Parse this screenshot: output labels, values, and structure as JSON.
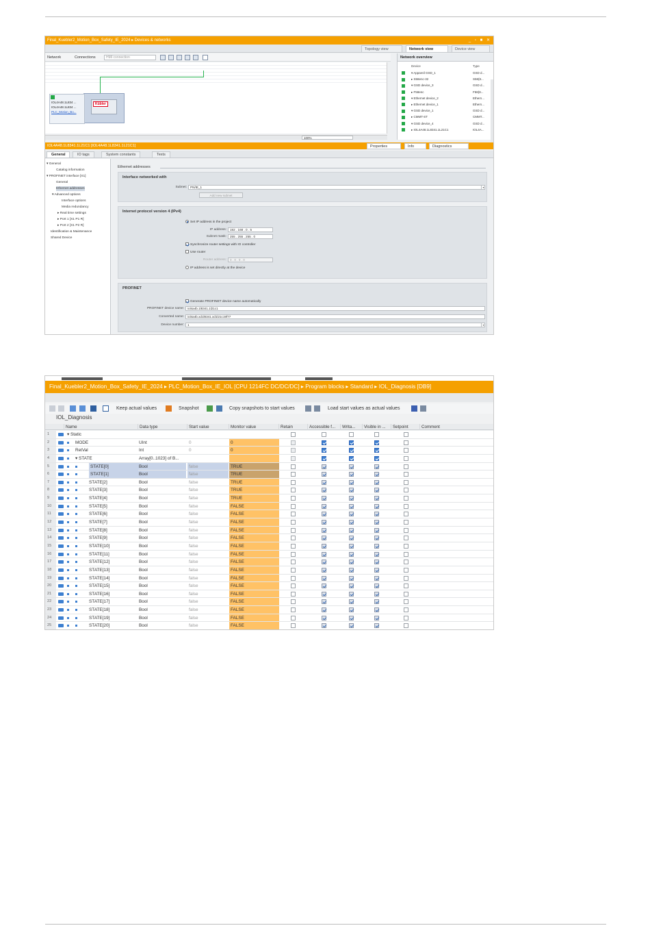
{
  "screenshot1": {
    "title": "Final_Kuebler2_Motion_Box_Safety_IE_2024 ▸ Devices & networks",
    "window_buttons": "_ ▫ ■ ✕",
    "view_tabs": [
      "Topology view",
      "Network view",
      "Device view"
    ],
    "toolbar": {
      "network": "Network",
      "connections": "Connections",
      "connection_type": "HMI connection"
    },
    "device_box": {
      "line1": "IOL4A48.1L834 ...",
      "line2": "IOL4A48.1L834 ...",
      "link": "PLC_Motion_Bo..."
    },
    "device_logo": "Kübler",
    "zoom": "100%",
    "overview": {
      "title": "Network overview",
      "col_device": "Device",
      "col_type": "Type",
      "rows": [
        {
          "name": "▾ Appareil GSD_1",
          "type": "GSD d..."
        },
        {
          "name": "  ▸ S58enc-32",
          "type": "S58(8..."
        },
        {
          "name": "▾ GSD device_3",
          "type": "GSD d..."
        },
        {
          "name": "  ▸ F58enc",
          "type": "F58(8..."
        },
        {
          "name": "▾ Ethernet device_2",
          "type": "Ethern..."
        },
        {
          "name": "  ▸ Ethernet device_1",
          "type": "Ethern..."
        },
        {
          "name": "▾ GSD device_1",
          "type": "GSD d..."
        },
        {
          "name": "  ▸ CMMT-ST",
          "type": "CMMT..."
        },
        {
          "name": "▾ GSD device_4",
          "type": "GSD d..."
        },
        {
          "name": "  ▸ IOL4A48.1L8341.1L21C1",
          "type": "IOL4A..."
        }
      ]
    },
    "info_title": "IOL4A48.1L8341.1L21C1 [IOL4A48.1L8341.1L21C1]",
    "prop_tabs": [
      "Properties",
      "Info",
      "Diagnostics"
    ],
    "general_tabs": [
      "General",
      "IO tags",
      "System constants",
      "Texts"
    ],
    "nav": [
      "▾ General",
      "Catalog information",
      "▾ PROFINET interface [X1]",
      "General",
      "Ethernet addresses",
      "▾ Advanced options",
      "Interface options",
      "Media redundancy",
      "▸ Real time settings",
      "▸ Port 1 [X1 P1 R]",
      "▸ Port 2 [X1 P2 R]",
      "Identification & Maintenance",
      "Shared Device"
    ],
    "section_title": "Ethernet addresses",
    "iface": {
      "title": "Interface networked with",
      "subnet_label": "Subnet:",
      "subnet_value": "PN/IE_1",
      "add_subnet": "Add new subnet"
    },
    "ipv4": {
      "title": "Internet protocol version 4 (IPv4)",
      "set_ip": "Set IP address in the project",
      "ip_label": "IP address:",
      "ip": [
        "192",
        "168",
        "0",
        "5"
      ],
      "mask_label": "Subnet mask:",
      "mask": [
        "255",
        "255",
        "255",
        "0"
      ],
      "sync_router": "Synchronize router settings with IO controller",
      "use_router": "Use router",
      "router_label": "Router address:",
      "router": [
        "0",
        "0",
        "0",
        "0"
      ],
      "ip_direct": "IP address is set directly at the device"
    },
    "profinet": {
      "title": "PROFINET",
      "generate": "Generate PROFINET device name automatically",
      "name_label": "PROFINET device name:",
      "name_value": "iol4a4b.1l8341.1l21c1",
      "conv_label": "Converted name:",
      "conv_value": "iol4a4b.xd1l8341.xd1l21c19f77",
      "num_label": "Device number:",
      "num_value": "1"
    }
  },
  "screenshot2": {
    "breadcrumb": "Final_Kuebler2_Motion_Box_Safety_IE_2024 ▸ PLC_Motion_Box_IE_IOL [CPU 1214FC DC/DC/DC] ▸ Program blocks ▸ Standard ▸ IOL_Diagnosis [DB9]",
    "toolbar": {
      "keep": "Keep actual values",
      "snapshot": "Snapshot",
      "copy": "Copy snapshots to start values",
      "load": "Load start values as actual values"
    },
    "block_name": "IOL_Diagnosis",
    "columns": [
      "",
      "Name",
      "Data type",
      "Start value",
      "Monitor value",
      "Retain",
      "Accessible f...",
      "Writa...",
      "Visible in ...",
      "Setpoint",
      "Comment"
    ],
    "rows": [
      {
        "n": "1",
        "name": "▾ Static",
        "dtype": "",
        "start": "",
        "monitor": "",
        "level": 0,
        "header": true,
        "sel": false
      },
      {
        "n": "2",
        "name": "MODE",
        "dtype": "UInt",
        "start": "0",
        "monitor": "0",
        "level": 1,
        "sel": false
      },
      {
        "n": "3",
        "name": "RetVal",
        "dtype": "Int",
        "start": "0",
        "monitor": "0",
        "level": 1,
        "sel": false
      },
      {
        "n": "4",
        "name": "▾ STATE",
        "dtype": "Array[0..1023] of B...",
        "start": "",
        "monitor": "",
        "level": 1,
        "sel": false
      },
      {
        "n": "5",
        "name": "STATE[0]",
        "dtype": "Bool",
        "start": "false",
        "monitor": "TRUE",
        "level": 2,
        "sel": true
      },
      {
        "n": "6",
        "name": "STATE[1]",
        "dtype": "Bool",
        "start": "false",
        "monitor": "TRUE",
        "level": 2,
        "sel": true
      },
      {
        "n": "7",
        "name": "STATE[2]",
        "dtype": "Bool",
        "start": "false",
        "monitor": "TRUE",
        "level": 2,
        "sel": false
      },
      {
        "n": "8",
        "name": "STATE[3]",
        "dtype": "Bool",
        "start": "false",
        "monitor": "TRUE",
        "level": 2,
        "sel": false
      },
      {
        "n": "9",
        "name": "STATE[4]",
        "dtype": "Bool",
        "start": "false",
        "monitor": "TRUE",
        "level": 2,
        "sel": false
      },
      {
        "n": "10",
        "name": "STATE[5]",
        "dtype": "Bool",
        "start": "false",
        "monitor": "FALSE",
        "level": 2,
        "sel": false
      },
      {
        "n": "11",
        "name": "STATE[6]",
        "dtype": "Bool",
        "start": "false",
        "monitor": "FALSE",
        "level": 2,
        "sel": false
      },
      {
        "n": "12",
        "name": "STATE[7]",
        "dtype": "Bool",
        "start": "false",
        "monitor": "FALSE",
        "level": 2,
        "sel": false
      },
      {
        "n": "13",
        "name": "STATE[8]",
        "dtype": "Bool",
        "start": "false",
        "monitor": "FALSE",
        "level": 2,
        "sel": false
      },
      {
        "n": "14",
        "name": "STATE[9]",
        "dtype": "Bool",
        "start": "false",
        "monitor": "FALSE",
        "level": 2,
        "sel": false
      },
      {
        "n": "15",
        "name": "STATE[10]",
        "dtype": "Bool",
        "start": "false",
        "monitor": "FALSE",
        "level": 2,
        "sel": false
      },
      {
        "n": "16",
        "name": "STATE[11]",
        "dtype": "Bool",
        "start": "false",
        "monitor": "FALSE",
        "level": 2,
        "sel": false
      },
      {
        "n": "17",
        "name": "STATE[12]",
        "dtype": "Bool",
        "start": "false",
        "monitor": "FALSE",
        "level": 2,
        "sel": false
      },
      {
        "n": "18",
        "name": "STATE[13]",
        "dtype": "Bool",
        "start": "false",
        "monitor": "FALSE",
        "level": 2,
        "sel": false
      },
      {
        "n": "19",
        "name": "STATE[14]",
        "dtype": "Bool",
        "start": "false",
        "monitor": "FALSE",
        "level": 2,
        "sel": false
      },
      {
        "n": "20",
        "name": "STATE[15]",
        "dtype": "Bool",
        "start": "false",
        "monitor": "FALSE",
        "level": 2,
        "sel": false
      },
      {
        "n": "21",
        "name": "STATE[16]",
        "dtype": "Bool",
        "start": "false",
        "monitor": "FALSE",
        "level": 2,
        "sel": false
      },
      {
        "n": "22",
        "name": "STATE[17]",
        "dtype": "Bool",
        "start": "false",
        "monitor": "FALSE",
        "level": 2,
        "sel": false
      },
      {
        "n": "23",
        "name": "STATE[18]",
        "dtype": "Bool",
        "start": "false",
        "monitor": "FALSE",
        "level": 2,
        "sel": false
      },
      {
        "n": "24",
        "name": "STATE[19]",
        "dtype": "Bool",
        "start": "false",
        "monitor": "FALSE",
        "level": 2,
        "sel": false
      },
      {
        "n": "25",
        "name": "STATE[20]",
        "dtype": "Bool",
        "start": "false",
        "monitor": "FALSE",
        "level": 2,
        "sel": false
      }
    ]
  },
  "colors": {
    "tia_orange": "#f5a000",
    "monitor_cell": "#ffc266",
    "selection": "#c7d3e8",
    "check_blue": "#3c7fd0"
  }
}
